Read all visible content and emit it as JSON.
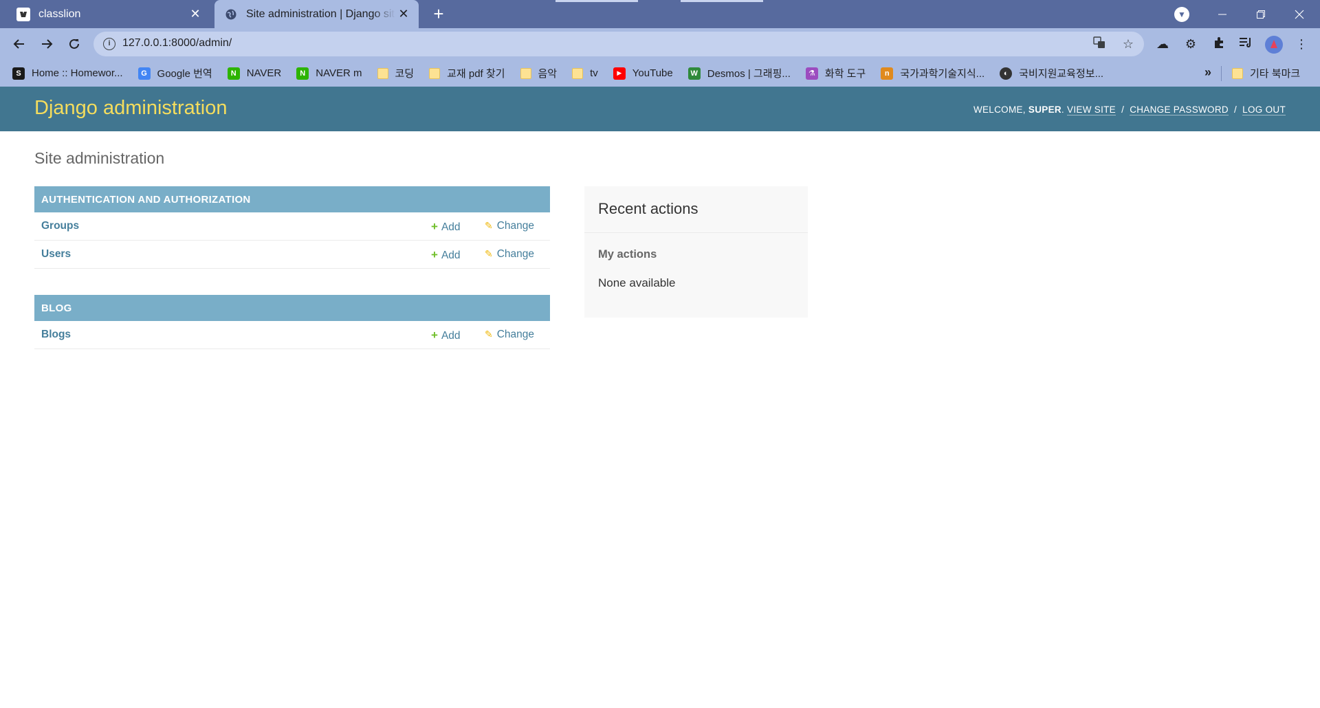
{
  "browser": {
    "tabs": [
      {
        "title": "classlion",
        "close": "✕"
      },
      {
        "title": "Site administration | Django site admin",
        "close": "✕"
      }
    ],
    "new_tab": "+",
    "url": "127.0.0.1:8000/admin/",
    "bookmarks": [
      {
        "label": "Home :: Homewor...",
        "icon": "S",
        "color": "#1a1a1a"
      },
      {
        "label": "Google 번역",
        "icon": "G",
        "color": "#4285f4"
      },
      {
        "label": "NAVER",
        "icon": "N",
        "color": "#2db400"
      },
      {
        "label": "NAVER m",
        "icon": "N",
        "color": "#2db400"
      },
      {
        "label": "코딩",
        "icon": "folder"
      },
      {
        "label": "교재 pdf 찾기",
        "icon": "folder"
      },
      {
        "label": "음악",
        "icon": "folder"
      },
      {
        "label": "tv",
        "icon": "folder"
      },
      {
        "label": "YouTube",
        "icon": "▶",
        "color": "#ff0000"
      },
      {
        "label": "Desmos | 그래핑...",
        "icon": "W",
        "color": "#2f8a3b"
      },
      {
        "label": "화학 도구",
        "icon": "⚗",
        "color": "#9c4cbf"
      },
      {
        "label": "국가과학기술지식...",
        "icon": "n",
        "color": "#e08a1e"
      },
      {
        "label": "국비지원교육정보...",
        "icon": "◐",
        "color": "#333333"
      }
    ],
    "more_bookmarks": "»",
    "other_bookmarks": "기타 북마크"
  },
  "header": {
    "branding": "Django administration",
    "welcome": "WELCOME,",
    "username": "SUPER",
    "view_site": "VIEW SITE",
    "change_password": "CHANGE PASSWORD",
    "log_out": "LOG OUT",
    "separator": "/"
  },
  "page_title": "Site administration",
  "modules": [
    {
      "caption": "AUTHENTICATION AND AUTHORIZATION",
      "rows": [
        {
          "name": "Groups",
          "add": "Add",
          "change": "Change"
        },
        {
          "name": "Users",
          "add": "Add",
          "change": "Change"
        }
      ]
    },
    {
      "caption": "BLOG",
      "rows": [
        {
          "name": "Blogs",
          "add": "Add",
          "change": "Change"
        }
      ]
    }
  ],
  "recent_actions": {
    "title": "Recent actions",
    "subtitle": "My actions",
    "empty": "None available"
  }
}
